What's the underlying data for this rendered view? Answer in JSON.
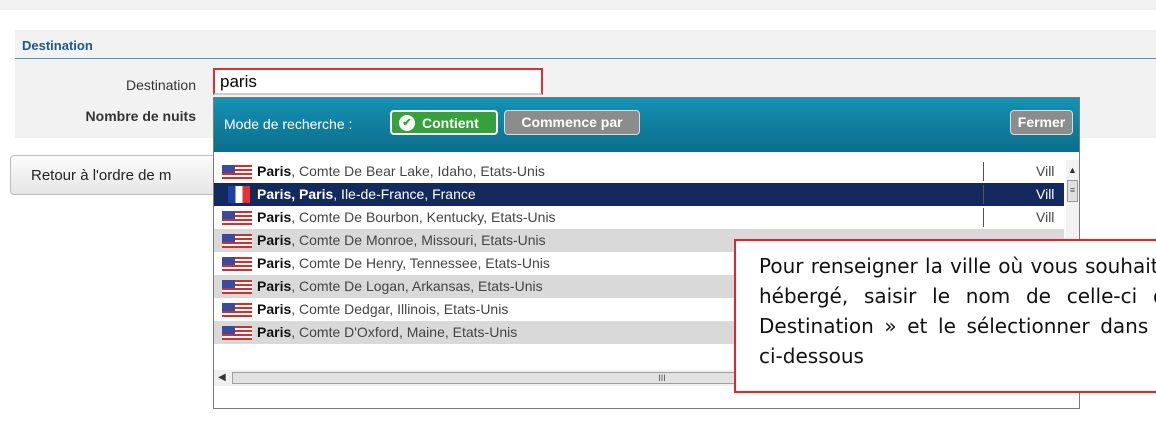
{
  "section": {
    "title": "Destination",
    "destination_label": "Destination",
    "destination_value": "paris",
    "nights_label": "Nombre de nuits"
  },
  "retour_button": "Retour à l'ordre de m",
  "dropdown": {
    "mode_label": "Mode de recherche :",
    "contient_label": "Contient",
    "commence_label": "Commence par",
    "fermer_label": "Fermer",
    "results": [
      {
        "flag": "us-flag-icon",
        "match": "Paris",
        "rest": ", Comte De Bear Lake, Idaho, Etats-Unis",
        "type": "Vill"
      },
      {
        "flag": "fr-flag-icon",
        "match": "Paris, Paris",
        "rest": ", Ile-de-France, France",
        "type": "Vill",
        "selected": true
      },
      {
        "flag": "us-flag-icon",
        "match": "Paris",
        "rest": ", Comte De Bourbon, Kentucky, Etats-Unis",
        "type": "Vill"
      },
      {
        "flag": "us-flag-icon",
        "match": "Paris",
        "rest": ", Comte De Monroe, Missouri, Etats-Unis",
        "type": ""
      },
      {
        "flag": "us-flag-icon",
        "match": "Paris",
        "rest": ", Comte De Henry, Tennessee, Etats-Unis",
        "type": ""
      },
      {
        "flag": "us-flag-icon",
        "match": "Paris",
        "rest": ", Comte De Logan, Arkansas, Etats-Unis",
        "type": ""
      },
      {
        "flag": "us-flag-icon",
        "match": "Paris",
        "rest": ", Comte Dedgar, Illinois, Etats-Unis",
        "type": ""
      },
      {
        "flag": "us-flag-icon",
        "match": "Paris",
        "rest": ", Comte D'Oxford, Maine, Etats-Unis",
        "type": ""
      }
    ],
    "hscroll_thumb": "III"
  },
  "tooltip": {
    "text": "Pour renseigner la ville où vous souhaitez être hébergé, saisir le nom de celle-ci dans « Destination » et le sélectionner dans la liste ci-dessous"
  },
  "colors": {
    "header_teal": "#1592b4",
    "selected_row": "#142a5e",
    "contient_green": "#36a13c",
    "tooltip_border": "#e02626"
  }
}
